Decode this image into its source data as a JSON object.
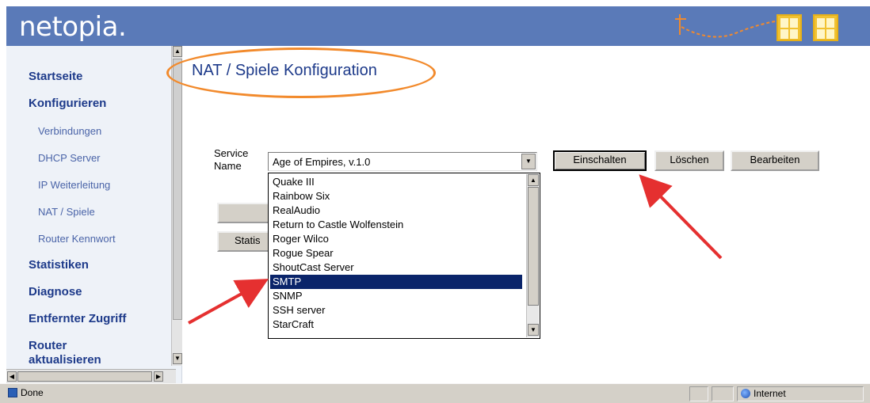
{
  "header": {
    "logo": "netopia."
  },
  "sidebar": {
    "items": [
      {
        "label": "Startseite"
      },
      {
        "label": "Konfigurieren"
      },
      {
        "label": "Verbindungen"
      },
      {
        "label": "DHCP Server"
      },
      {
        "label": "IP Weiterleitung"
      },
      {
        "label": "NAT / Spiele"
      },
      {
        "label": "Router Kennwort"
      },
      {
        "label": "Statistiken"
      },
      {
        "label": "Diagnose"
      },
      {
        "label": "Entfernter Zugriff"
      },
      {
        "label": "Router aktualisieren"
      }
    ]
  },
  "main": {
    "title": "NAT / Spiele Konfiguration",
    "service_label": "Service Name",
    "select_value": "Age of Empires, v.1.0",
    "options": [
      "Quake III",
      "Rainbow Six",
      "RealAudio",
      "Return to Castle Wolfenstein",
      "Roger Wilco",
      "Rogue Spear",
      "ShoutCast Server",
      "SMTP",
      "SNMP",
      "SSH server",
      "StarCraft"
    ],
    "selected_option": "SMTP",
    "buttons": {
      "enable": "Einschalten",
      "delete": "Löschen",
      "edit": "Bearbeiten",
      "stats_partial": "Statis"
    }
  },
  "statusbar": {
    "left": "Done",
    "zone": "Internet"
  },
  "colors": {
    "header_bg": "#5a7ab8",
    "nav_text": "#1d3a8a",
    "highlight": "#0a246a",
    "annotation": "#f28a2c",
    "arrow": "#e53030"
  }
}
